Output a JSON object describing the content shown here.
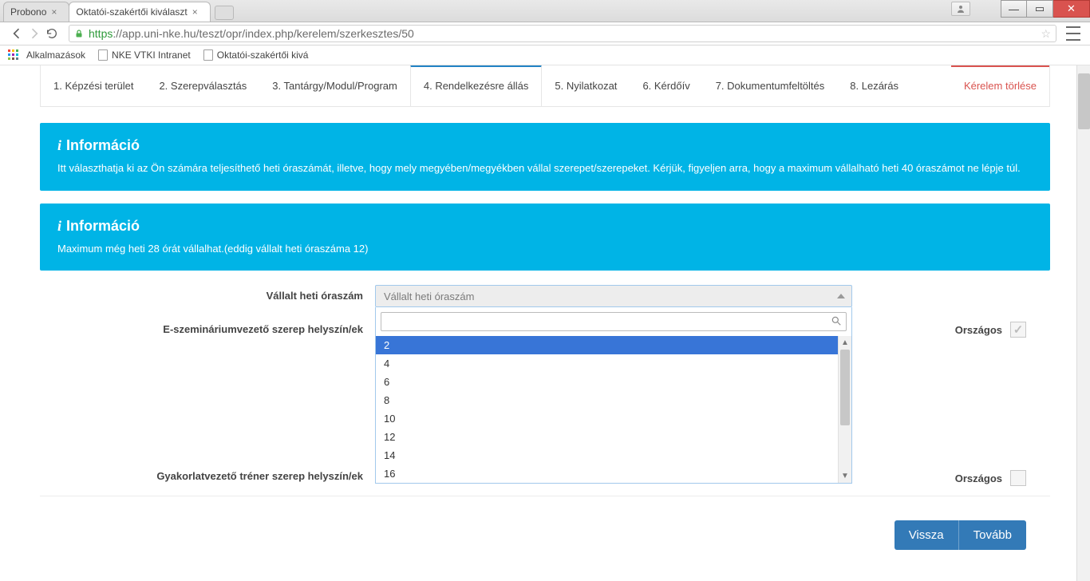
{
  "browser": {
    "tabs": [
      {
        "title": "Probono",
        "active": false
      },
      {
        "title": "Oktatói-szakértői kiválaszt",
        "active": true
      }
    ],
    "url_https": "https",
    "url_rest": "://app.uni-nke.hu/teszt/opr/index.php/kerelem/szerkesztes/50",
    "bookmarks": {
      "apps": "Alkalmazások",
      "items": [
        "NKE VTKI Intranet",
        "Oktatói-szakértői kivá"
      ]
    }
  },
  "wizard": {
    "items": [
      "1. Képzési terület",
      "2. Szerepválasztás",
      "3. Tantárgy/Modul/Program",
      "4. Rendelkezésre állás",
      "5. Nyilatkozat",
      "6. Kérdőív",
      "7. Dokumentumfeltöltés",
      "8. Lezárás"
    ],
    "delete": "Kérelem törlése",
    "active_index": 3
  },
  "info1": {
    "title": "Információ",
    "body": "Itt választhatja ki az Ön számára teljesíthető heti óraszámát, illetve, hogy mely megyében/megyékben vállal szerepet/szerepeket. Kérjük, figyeljen arra, hogy a maximum vállalható heti 40 óraszámot ne lépje túl."
  },
  "info2": {
    "title": "Információ",
    "body": "Maximum még heti 28 órát vállalhat.(eddig vállalt heti óraszáma 12)"
  },
  "form": {
    "hours_label": "Vállalt heti óraszám",
    "hours_placeholder": "Vállalt heti óraszám",
    "esem_label": "E-szemináriumvezető szerep helyszín/ek",
    "trainer_label": "Gyakorlatvezető tréner szerep helyszín/ek",
    "countrywide": "Országos"
  },
  "dropdown": {
    "options": [
      "2",
      "4",
      "6",
      "8",
      "10",
      "12",
      "14",
      "16"
    ],
    "selected_index": 0
  },
  "buttons": {
    "back": "Vissza",
    "next": "Tovább"
  }
}
